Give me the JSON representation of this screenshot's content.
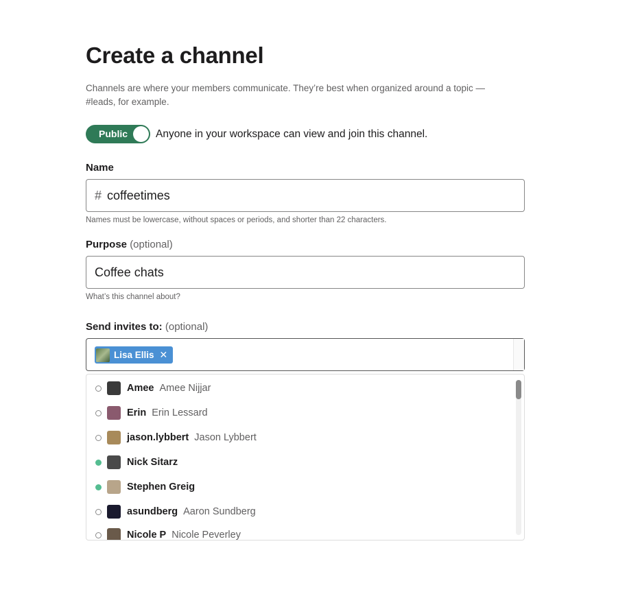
{
  "page": {
    "title": "Create a channel",
    "description": "Channels are where your members communicate. They’re best when organized around a topic — #leads, for example."
  },
  "visibility": {
    "toggle_label": "Public",
    "toggle_state": "on",
    "description": "Anyone in your workspace can view and join this channel."
  },
  "name_field": {
    "label": "Name",
    "prefix": "#",
    "value": "coffeetimes",
    "hint": "Names must be lowercase, without spaces or periods, and shorter than 22 characters."
  },
  "purpose_field": {
    "label": "Purpose",
    "optional": "(optional)",
    "value": "Coffee chats",
    "hint": "What’s this channel about?"
  },
  "invites": {
    "label": "Send invites to:",
    "optional": "(optional)",
    "selected": [
      {
        "name": "Lisa Ellis",
        "remove_icon": "close-icon"
      }
    ],
    "suggestions": [
      {
        "username": "Amee",
        "real_name": "Amee Nijjar",
        "status": "away",
        "avatar_color": "#3a3a3a"
      },
      {
        "username": "Erin",
        "real_name": "Erin Lessard",
        "status": "away",
        "avatar_color": "#8a5a6e"
      },
      {
        "username": "jason.lybbert",
        "real_name": "Jason Lybbert",
        "status": "away",
        "avatar_color": "#a88a5a"
      },
      {
        "username": "Nick Sitarz",
        "real_name": "",
        "status": "active",
        "avatar_color": "#4a4a4a"
      },
      {
        "username": "Stephen Greig",
        "real_name": "",
        "status": "active",
        "avatar_color": "#b8a58a"
      },
      {
        "username": "asundberg",
        "real_name": "Aaron Sundberg",
        "status": "away",
        "avatar_color": "#1a1a2e"
      },
      {
        "username": "Nicole P",
        "real_name": "Nicole Peverley",
        "status": "away",
        "avatar_color": "#6a5a4a"
      }
    ]
  },
  "colors": {
    "toggle_on": "#2f7a57",
    "chip": "#4a90d4",
    "active_status": "#2bac76"
  }
}
